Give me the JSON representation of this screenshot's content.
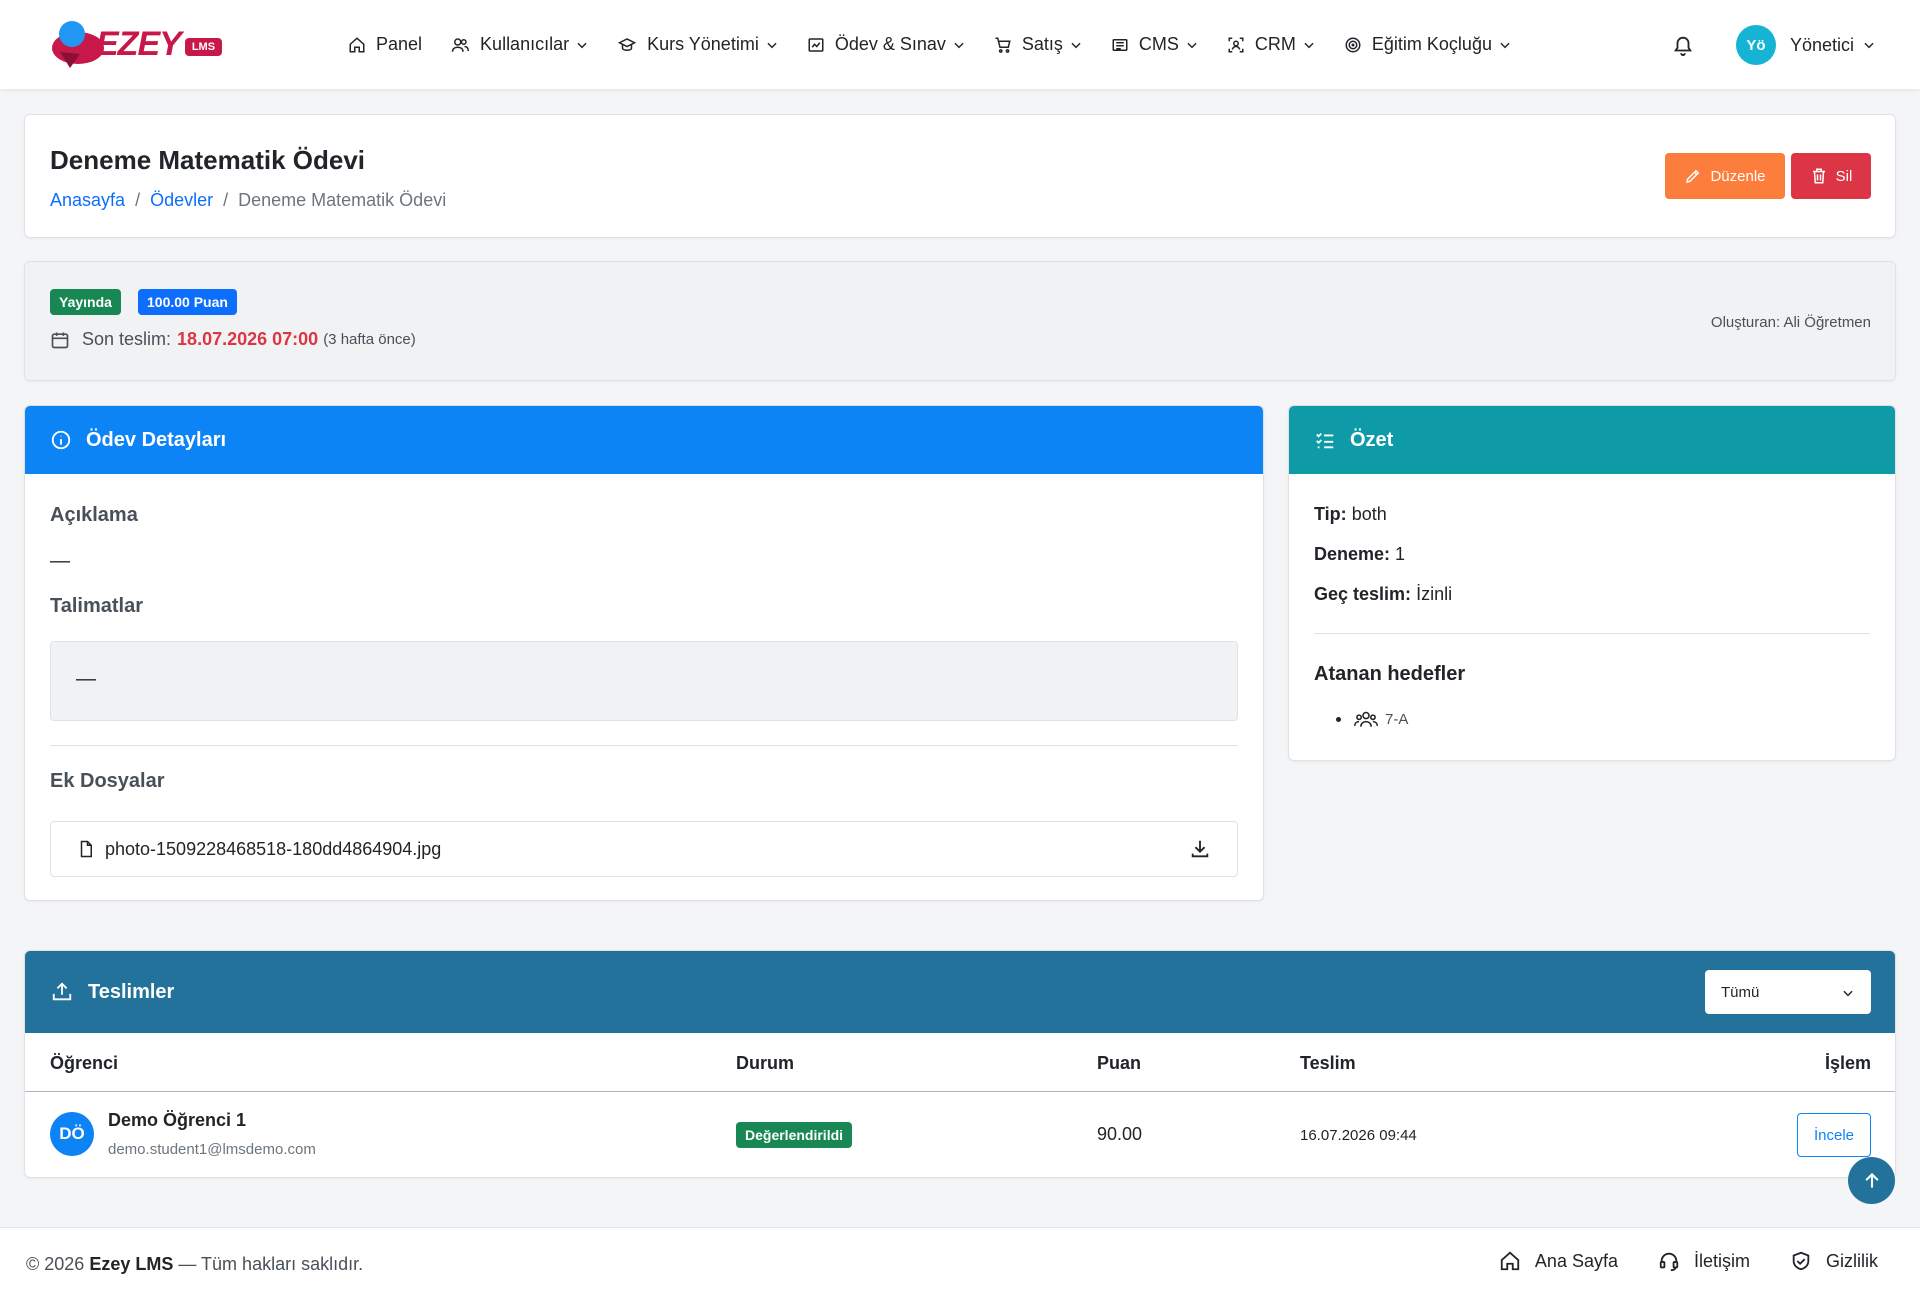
{
  "brand": {
    "name": "EZEY",
    "badge": "LMS"
  },
  "nav": {
    "items": [
      {
        "label": "Panel"
      },
      {
        "label": "Kullanıcılar"
      },
      {
        "label": "Kurs Yönetimi"
      },
      {
        "label": "Ödev & Sınav"
      },
      {
        "label": "Satış"
      },
      {
        "label": "CMS"
      },
      {
        "label": "CRM"
      },
      {
        "label": "Eğitim Koçluğu"
      }
    ],
    "user": {
      "initials": "Yö",
      "name": "Yönetici"
    }
  },
  "header": {
    "title": "Deneme Matematik Ödevi",
    "breadcrumb": [
      "Anasayfa",
      "Ödevler",
      "Deneme Matematik Ödevi"
    ],
    "edit_label": "Düzenle",
    "delete_label": "Sil"
  },
  "meta": {
    "status": "Yayında",
    "points": "100.00 Puan",
    "deadline_label": "Son teslim:",
    "deadline_date": "18.07.2026 07:00",
    "deadline_relative": "(3 hafta önce)",
    "creator": "Oluşturan: Ali Öğretmen"
  },
  "details": {
    "title": "Ödev Detayları",
    "description_title": "Açıklama",
    "description_value": "—",
    "instructions_title": "Talimatlar",
    "instructions_value": "—",
    "attachments_title": "Ek Dosyalar",
    "file_name": "photo-1509228468518-180dd4864904.jpg"
  },
  "summary": {
    "title": "Özet",
    "type_label": "Tip:",
    "type_value": "both",
    "attempt_label": "Deneme:",
    "attempt_value": "1",
    "late_label": "Geç teslim:",
    "late_value": "İzinli",
    "targets_title": "Atanan hedefler",
    "targets": [
      "7-A"
    ]
  },
  "submissions": {
    "title": "Teslimler",
    "filter_value": "Tümü",
    "columns": [
      "Öğrenci",
      "Durum",
      "Puan",
      "Teslim",
      "İşlem"
    ],
    "rows": [
      {
        "initials": "DÖ",
        "name": "Demo Öğrenci 1",
        "email": "demo.student1@lmsdemo.com",
        "status": "Değerlendirildi",
        "score": "90.00",
        "submitted": "16.07.2026 09:44",
        "action": "İncele"
      }
    ]
  },
  "footer": {
    "year_text": "© 2026",
    "brand": "Ezey LMS",
    "rights": "— Tüm hakları saklıdır.",
    "links": [
      "Ana Sayfa",
      "İletişim",
      "Gizlilik"
    ]
  },
  "colors": {
    "primary": "#0d84f5",
    "teal": "#0e9aa7",
    "submissions_header": "#22729b",
    "success": "#198754",
    "danger": "#dc3545",
    "warning": "#fd7e3c",
    "brand": "#c8184a"
  }
}
